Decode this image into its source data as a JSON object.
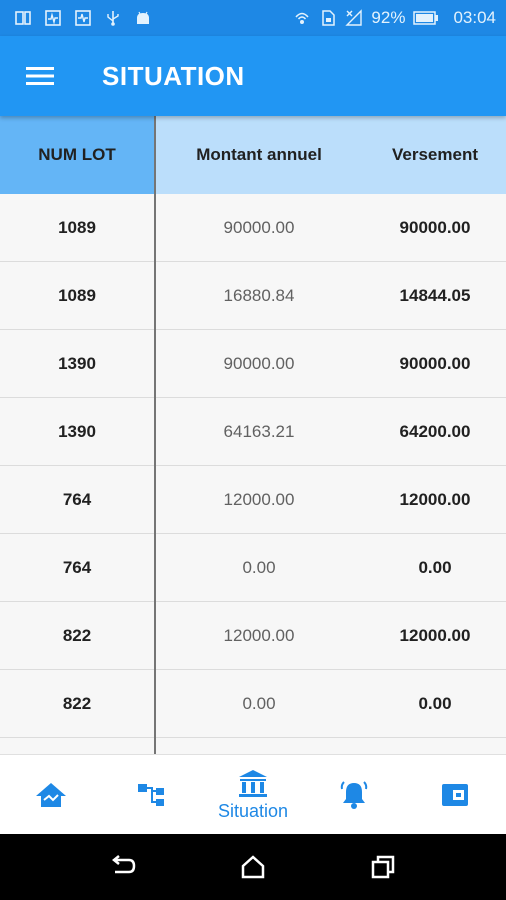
{
  "status_bar": {
    "battery": "92%",
    "time": "03:04"
  },
  "app_bar": {
    "title": "SITUATION",
    "menu_icon": "hamburger-menu-icon"
  },
  "table": {
    "headers": [
      "NUM LOT",
      "Montant annuel",
      "Versement"
    ],
    "rows": [
      [
        "1089",
        "90000.00",
        "90000.00"
      ],
      [
        "1089",
        "16880.84",
        "14844.05"
      ],
      [
        "1390",
        "90000.00",
        "90000.00"
      ],
      [
        "1390",
        "64163.21",
        "64200.00"
      ],
      [
        "764",
        "12000.00",
        "12000.00"
      ],
      [
        "764",
        "0.00",
        "0.00"
      ],
      [
        "822",
        "12000.00",
        "12000.00"
      ],
      [
        "822",
        "0.00",
        "0.00"
      ]
    ]
  },
  "bottom_nav": {
    "items": [
      {
        "icon": "home-icon",
        "label": ""
      },
      {
        "icon": "hierarchy-icon",
        "label": ""
      },
      {
        "icon": "bank-icon",
        "label": "Situation"
      },
      {
        "icon": "bell-icon",
        "label": ""
      },
      {
        "icon": "wallet-icon",
        "label": ""
      }
    ]
  },
  "colors": {
    "primary": "#2196f3",
    "status": "#1e88e5",
    "header_light": "#bbdefb",
    "header_accent": "#64b5f6"
  }
}
